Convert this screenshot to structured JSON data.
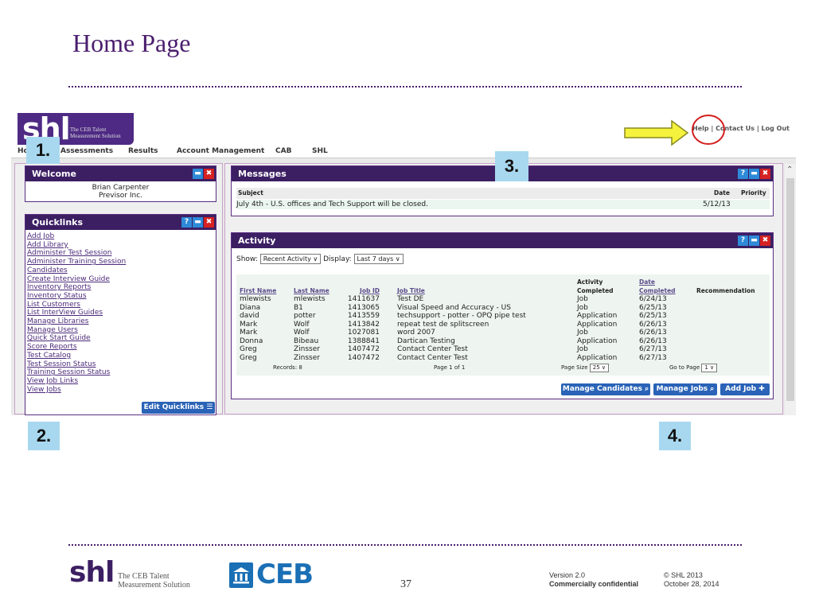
{
  "slide": {
    "title": "Home Page",
    "page_number": "37",
    "version": "Version 2.0",
    "confidential": "Commercially confidential",
    "copyright": "© SHL 2013",
    "date": "October 28, 2014"
  },
  "branding": {
    "logo_mark": "shl",
    "logo_tagline_line1": "The CEB Talent",
    "logo_tagline_line2": "Measurement Solution",
    "ceb_logo": "CEB",
    "accent_color": "#4b1e6e",
    "panel_header_color": "#3c1f63"
  },
  "callouts": {
    "c1": "1.",
    "c2": "2.",
    "c3": "3.",
    "c4": "4."
  },
  "top_links": {
    "help": "Help",
    "sep": "|",
    "contact": "Contact Us",
    "logout": "Log Out"
  },
  "nav": {
    "home": "Ho",
    "assessments": "Assessments",
    "results": "Results",
    "account": "Account Management",
    "cab": "CAB",
    "shl": "SHL"
  },
  "welcome": {
    "title": "Welcome",
    "name": "Brian Carpenter",
    "company": "Previsor Inc."
  },
  "quicklinks": {
    "title": "Quicklinks",
    "links": [
      "Add Job",
      "Add Library",
      "Administer Test Session",
      "Administer Training Session",
      "Candidates",
      "Create Interview Guide",
      "Inventory Reports",
      "Inventory Status",
      "List Customers",
      "List InterView Guides",
      "Manage Libraries",
      "Manage Users",
      "Quick Start Guide",
      "Score Reports",
      "Test Catalog",
      "Test Session Status",
      "Training Session Status",
      "View Job Links",
      "View Jobs"
    ],
    "edit_button": "Edit Quicklinks ☰"
  },
  "messages": {
    "title": "Messages",
    "col_subject": "Subject",
    "col_date": "Date",
    "col_priority": "Priority",
    "rows": [
      {
        "subject": "July 4th - U.S. offices and Tech Support will be closed.",
        "date": "5/12/13",
        "priority": ""
      }
    ]
  },
  "activity": {
    "title": "Activity",
    "show_label": "Show:",
    "show_value": "Recent Activity ∨",
    "display_label": "Display:",
    "display_value": "Last 7 days ∨",
    "headers": {
      "first": "First Name",
      "last": "Last Name",
      "job_id": "Job ID",
      "job_title": "Job Title",
      "activity_line1": "Activity",
      "activity_line2": "Completed",
      "date_line1": "Date",
      "date_line2": "Completed",
      "recommendation": "Recommendation"
    },
    "rows": [
      {
        "first": "mlewists",
        "last": "mlewists",
        "job_id": "1411637",
        "job_title": "Test DE",
        "activity": "Job",
        "date": "6/24/13"
      },
      {
        "first": "Diana",
        "last": "B1",
        "job_id": "1413065",
        "job_title": "Visual Speed and Accuracy - US",
        "activity": "Job",
        "date": "6/25/13"
      },
      {
        "first": "david",
        "last": "potter",
        "job_id": "1413559",
        "job_title": "techsupport - potter - OPQ pipe test",
        "activity": "Application",
        "date": "6/25/13"
      },
      {
        "first": "Mark",
        "last": "Wolf",
        "job_id": "1413842",
        "job_title": "repeat test de splitscreen",
        "activity": "Application",
        "date": "6/26/13"
      },
      {
        "first": "Mark",
        "last": "Wolf",
        "job_id": "1027081",
        "job_title": "word 2007",
        "activity": "Job",
        "date": "6/26/13"
      },
      {
        "first": "Donna",
        "last": "Bibeau",
        "job_id": "1388841",
        "job_title": "Dartican Testing",
        "activity": "Application",
        "date": "6/26/13"
      },
      {
        "first": "Greg",
        "last": "Zinsser",
        "job_id": "1407472",
        "job_title": "Contact Center Test",
        "activity": "Job",
        "date": "6/27/13"
      },
      {
        "first": "Greg",
        "last": "Zinsser",
        "job_id": "1407472",
        "job_title": "Contact Center Test",
        "activity": "Application",
        "date": "6/27/13"
      }
    ],
    "records": "Records: 8",
    "page_info": "Page 1 of 1",
    "page_size_label": "Page Size",
    "page_size_value": "25 ∨",
    "goto_label": "Go to Page",
    "goto_value": "1 ∨",
    "btn_manage_candidates": "Manage Candidates ⌕",
    "btn_manage_jobs": "Manage Jobs ⌕",
    "btn_add_job": "Add Job ✚"
  },
  "icons": {
    "help": "help-icon",
    "minimize": "minimize-icon",
    "close": "close-icon",
    "scroll_up": "chevron-up-icon"
  }
}
